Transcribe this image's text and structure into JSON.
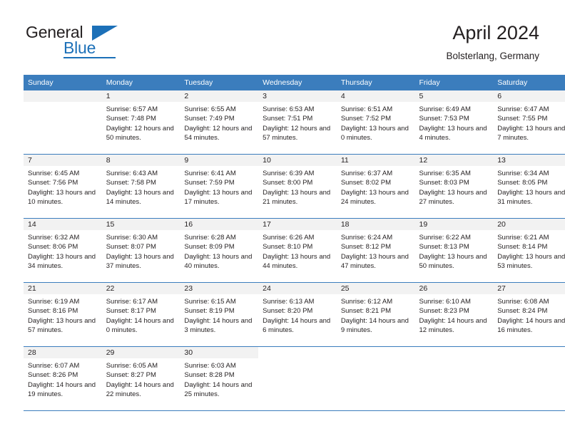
{
  "brand": {
    "name_top": "General",
    "name_bottom": "Blue",
    "accent_color": "#1c70b8"
  },
  "header": {
    "title": "April 2024",
    "subtitle": "Bolsterlang, Germany"
  },
  "theme": {
    "header_blue": "#3b7dbd",
    "daynum_band": "#f2f2f2",
    "text": "#231f20"
  },
  "weekdays": [
    "Sunday",
    "Monday",
    "Tuesday",
    "Wednesday",
    "Thursday",
    "Friday",
    "Saturday"
  ],
  "labels": {
    "sunrise": "Sunrise:",
    "sunset": "Sunset:",
    "daylight": "Daylight:"
  },
  "weeks": [
    [
      {
        "day": "",
        "sunrise": "",
        "sunset": "",
        "daylight": "",
        "empty": true
      },
      {
        "day": "1",
        "sunrise": "Sunrise: 6:57 AM",
        "sunset": "Sunset: 7:48 PM",
        "daylight": "Daylight: 12 hours and 50 minutes."
      },
      {
        "day": "2",
        "sunrise": "Sunrise: 6:55 AM",
        "sunset": "Sunset: 7:49 PM",
        "daylight": "Daylight: 12 hours and 54 minutes."
      },
      {
        "day": "3",
        "sunrise": "Sunrise: 6:53 AM",
        "sunset": "Sunset: 7:51 PM",
        "daylight": "Daylight: 12 hours and 57 minutes."
      },
      {
        "day": "4",
        "sunrise": "Sunrise: 6:51 AM",
        "sunset": "Sunset: 7:52 PM",
        "daylight": "Daylight: 13 hours and 0 minutes."
      },
      {
        "day": "5",
        "sunrise": "Sunrise: 6:49 AM",
        "sunset": "Sunset: 7:53 PM",
        "daylight": "Daylight: 13 hours and 4 minutes."
      },
      {
        "day": "6",
        "sunrise": "Sunrise: 6:47 AM",
        "sunset": "Sunset: 7:55 PM",
        "daylight": "Daylight: 13 hours and 7 minutes."
      }
    ],
    [
      {
        "day": "7",
        "sunrise": "Sunrise: 6:45 AM",
        "sunset": "Sunset: 7:56 PM",
        "daylight": "Daylight: 13 hours and 10 minutes."
      },
      {
        "day": "8",
        "sunrise": "Sunrise: 6:43 AM",
        "sunset": "Sunset: 7:58 PM",
        "daylight": "Daylight: 13 hours and 14 minutes."
      },
      {
        "day": "9",
        "sunrise": "Sunrise: 6:41 AM",
        "sunset": "Sunset: 7:59 PM",
        "daylight": "Daylight: 13 hours and 17 minutes."
      },
      {
        "day": "10",
        "sunrise": "Sunrise: 6:39 AM",
        "sunset": "Sunset: 8:00 PM",
        "daylight": "Daylight: 13 hours and 21 minutes."
      },
      {
        "day": "11",
        "sunrise": "Sunrise: 6:37 AM",
        "sunset": "Sunset: 8:02 PM",
        "daylight": "Daylight: 13 hours and 24 minutes."
      },
      {
        "day": "12",
        "sunrise": "Sunrise: 6:35 AM",
        "sunset": "Sunset: 8:03 PM",
        "daylight": "Daylight: 13 hours and 27 minutes."
      },
      {
        "day": "13",
        "sunrise": "Sunrise: 6:34 AM",
        "sunset": "Sunset: 8:05 PM",
        "daylight": "Daylight: 13 hours and 31 minutes."
      }
    ],
    [
      {
        "day": "14",
        "sunrise": "Sunrise: 6:32 AM",
        "sunset": "Sunset: 8:06 PM",
        "daylight": "Daylight: 13 hours and 34 minutes."
      },
      {
        "day": "15",
        "sunrise": "Sunrise: 6:30 AM",
        "sunset": "Sunset: 8:07 PM",
        "daylight": "Daylight: 13 hours and 37 minutes."
      },
      {
        "day": "16",
        "sunrise": "Sunrise: 6:28 AM",
        "sunset": "Sunset: 8:09 PM",
        "daylight": "Daylight: 13 hours and 40 minutes."
      },
      {
        "day": "17",
        "sunrise": "Sunrise: 6:26 AM",
        "sunset": "Sunset: 8:10 PM",
        "daylight": "Daylight: 13 hours and 44 minutes."
      },
      {
        "day": "18",
        "sunrise": "Sunrise: 6:24 AM",
        "sunset": "Sunset: 8:12 PM",
        "daylight": "Daylight: 13 hours and 47 minutes."
      },
      {
        "day": "19",
        "sunrise": "Sunrise: 6:22 AM",
        "sunset": "Sunset: 8:13 PM",
        "daylight": "Daylight: 13 hours and 50 minutes."
      },
      {
        "day": "20",
        "sunrise": "Sunrise: 6:21 AM",
        "sunset": "Sunset: 8:14 PM",
        "daylight": "Daylight: 13 hours and 53 minutes."
      }
    ],
    [
      {
        "day": "21",
        "sunrise": "Sunrise: 6:19 AM",
        "sunset": "Sunset: 8:16 PM",
        "daylight": "Daylight: 13 hours and 57 minutes."
      },
      {
        "day": "22",
        "sunrise": "Sunrise: 6:17 AM",
        "sunset": "Sunset: 8:17 PM",
        "daylight": "Daylight: 14 hours and 0 minutes."
      },
      {
        "day": "23",
        "sunrise": "Sunrise: 6:15 AM",
        "sunset": "Sunset: 8:19 PM",
        "daylight": "Daylight: 14 hours and 3 minutes."
      },
      {
        "day": "24",
        "sunrise": "Sunrise: 6:13 AM",
        "sunset": "Sunset: 8:20 PM",
        "daylight": "Daylight: 14 hours and 6 minutes."
      },
      {
        "day": "25",
        "sunrise": "Sunrise: 6:12 AM",
        "sunset": "Sunset: 8:21 PM",
        "daylight": "Daylight: 14 hours and 9 minutes."
      },
      {
        "day": "26",
        "sunrise": "Sunrise: 6:10 AM",
        "sunset": "Sunset: 8:23 PM",
        "daylight": "Daylight: 14 hours and 12 minutes."
      },
      {
        "day": "27",
        "sunrise": "Sunrise: 6:08 AM",
        "sunset": "Sunset: 8:24 PM",
        "daylight": "Daylight: 14 hours and 16 minutes."
      }
    ],
    [
      {
        "day": "28",
        "sunrise": "Sunrise: 6:07 AM",
        "sunset": "Sunset: 8:26 PM",
        "daylight": "Daylight: 14 hours and 19 minutes."
      },
      {
        "day": "29",
        "sunrise": "Sunrise: 6:05 AM",
        "sunset": "Sunset: 8:27 PM",
        "daylight": "Daylight: 14 hours and 22 minutes."
      },
      {
        "day": "30",
        "sunrise": "Sunrise: 6:03 AM",
        "sunset": "Sunset: 8:28 PM",
        "daylight": "Daylight: 14 hours and 25 minutes."
      },
      {
        "day": "",
        "sunrise": "",
        "sunset": "",
        "daylight": "",
        "blank": true
      },
      {
        "day": "",
        "sunrise": "",
        "sunset": "",
        "daylight": "",
        "blank": true
      },
      {
        "day": "",
        "sunrise": "",
        "sunset": "",
        "daylight": "",
        "blank": true
      },
      {
        "day": "",
        "sunrise": "",
        "sunset": "",
        "daylight": "",
        "blank": true
      }
    ]
  ]
}
